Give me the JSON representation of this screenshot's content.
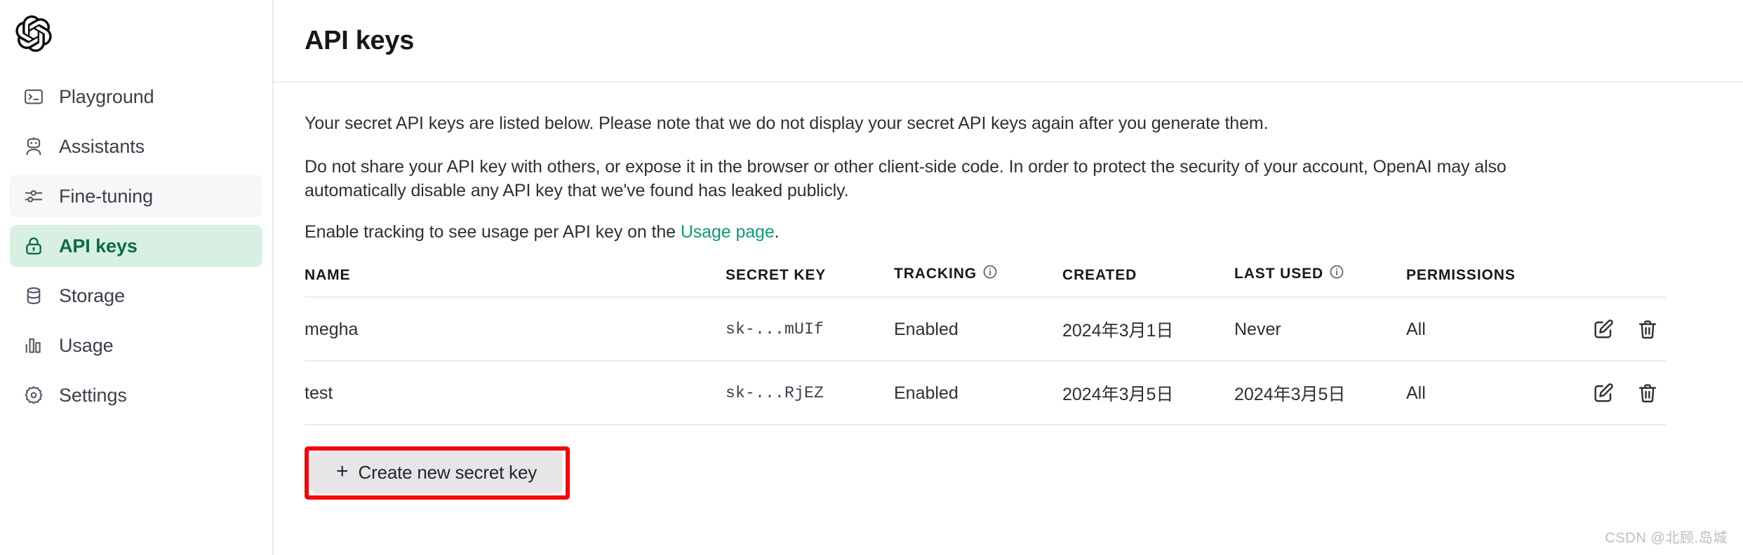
{
  "sidebar": {
    "logo": "openai-logo",
    "items": [
      {
        "label": "Playground",
        "icon": "terminal-icon",
        "state": "default"
      },
      {
        "label": "Assistants",
        "icon": "robot-icon",
        "state": "default"
      },
      {
        "label": "Fine-tuning",
        "icon": "sliders-icon",
        "state": "hovered"
      },
      {
        "label": "API keys",
        "icon": "lock-icon",
        "state": "active"
      },
      {
        "label": "Storage",
        "icon": "database-icon",
        "state": "default"
      },
      {
        "label": "Usage",
        "icon": "bar-chart-icon",
        "state": "default"
      },
      {
        "label": "Settings",
        "icon": "gear-icon",
        "state": "default"
      }
    ]
  },
  "header": {
    "title": "API keys"
  },
  "body": {
    "paragraph1": "Your secret API keys are listed below. Please note that we do not display your secret API keys again after you generate them.",
    "paragraph2": "Do not share your API key with others, or expose it in the browser or other client-side code. In order to protect the security of your account, OpenAI may also automatically disable any API key that we've found has leaked publicly.",
    "paragraph3_prefix": "Enable tracking to see usage per API key on the ",
    "paragraph3_link": "Usage page",
    "paragraph3_suffix": "."
  },
  "table": {
    "headers": {
      "name": "NAME",
      "secret_key": "SECRET KEY",
      "tracking": "TRACKING",
      "created": "CREATED",
      "last_used": "LAST USED",
      "permissions": "PERMISSIONS"
    },
    "rows": [
      {
        "name": "megha",
        "secret_key": "sk-...mUIf",
        "tracking": "Enabled",
        "created": "2024年3月1日",
        "last_used": "Never",
        "permissions": "All",
        "edit_icon": "edit-icon",
        "delete_icon": "trash-icon"
      },
      {
        "name": "test",
        "secret_key": "sk-...RjEZ",
        "tracking": "Enabled",
        "created": "2024年3月5日",
        "last_used": "2024年3月5日",
        "permissions": "All",
        "edit_icon": "edit-icon",
        "delete_icon": "trash-icon"
      }
    ]
  },
  "create_button": {
    "plus": "+",
    "label": "Create new secret key"
  },
  "annotation": {
    "color": "#f50505",
    "target": "create-new-secret-key-button"
  },
  "watermark": {
    "text": "CSDN @北顾.岛城"
  },
  "colors": {
    "accent_green": "#0e9b73",
    "active_nav_bg": "#d7f0e2",
    "active_nav_text": "#0d6b44",
    "border": "#ececeb",
    "text_primary": "#2e3033",
    "button_bg": "#e6e6e8",
    "annotation_red": "#f50505"
  }
}
